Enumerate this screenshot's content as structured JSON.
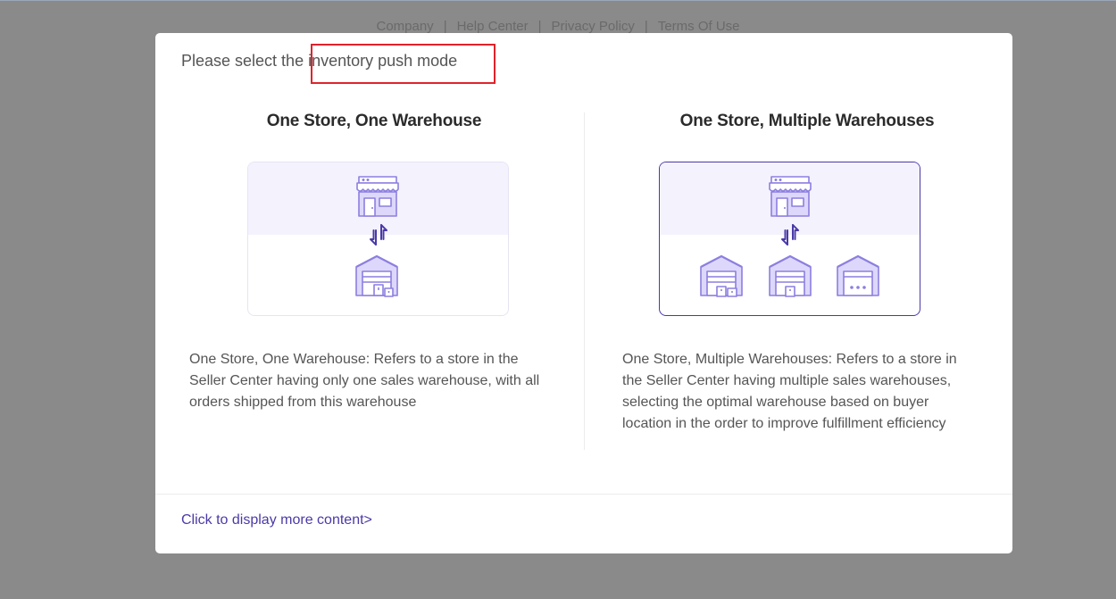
{
  "footer": {
    "links": [
      "Company",
      "Help Center",
      "Privacy Policy",
      "Terms Of Use"
    ],
    "separator": "|"
  },
  "modal": {
    "title": "Please select the inventory push mode",
    "options": [
      {
        "title": "One Store, One Warehouse",
        "description": "One Store, One Warehouse: Refers to a store in the Seller Center having only one sales warehouse, with all orders shipped from this warehouse",
        "selected": false
      },
      {
        "title": "One Store, Multiple Warehouses",
        "description": "One Store, Multiple Warehouses: Refers to a store in the Seller Center having multiple sales warehouses, selecting the optimal warehouse based on buyer location in the order to improve fulfillment efficiency",
        "selected": true
      }
    ],
    "more_link": "Click to display more content>"
  },
  "icons": {
    "store": "store-icon",
    "sync": "sync-arrows-icon",
    "warehouse": "warehouse-icon"
  },
  "colors": {
    "accent": "#4a3aa8",
    "icon_stroke": "#8c7fe0",
    "icon_fill": "#ddd8fb",
    "card_top_bg": "#f4f2fd",
    "highlight": "#e0232b",
    "overlay": "#8a8a8a"
  }
}
